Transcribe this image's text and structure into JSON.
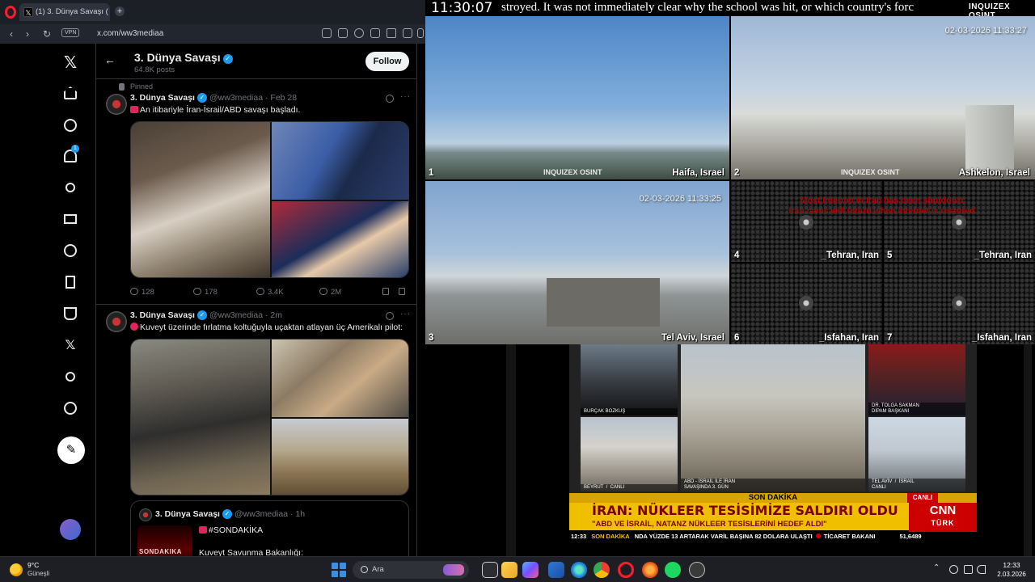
{
  "browser": {
    "tab_title": "(1) 3. Dünya Savaşı (@ww",
    "vpn_label": "VPN",
    "url": "x.com/ww3mediaa"
  },
  "profile": {
    "name": "3. Dünya Savaşı",
    "posts_count": "64.8K posts",
    "follow_label": "Follow"
  },
  "rail": {
    "notification_count": "1"
  },
  "tweets": [
    {
      "pinned_label": "Pinned",
      "author": "3. Dünya Savaşı",
      "handle": "@ww3mediaa · Feb 28",
      "text": "An itibariyle İran-İsrail/ABD savaşı başladı.",
      "replies": "128",
      "reposts": "178",
      "likes": "3.4K",
      "views": "2M"
    },
    {
      "author": "3. Dünya Savaşı",
      "handle": "@ww3mediaa · 2m",
      "text": "Kuveyt üzerinde fırlatma koltuğuyla uçaktan atlayan üç Amerikalı pilot:"
    }
  ],
  "quote": {
    "author": "3. Dünya Savaşı",
    "handle": "@ww3mediaa · 1h",
    "thumb_label": "SONDAKIKA",
    "hashtag": "#SONDAKİKA",
    "line2": "Kuveyt Savunma Bakanlığı:"
  },
  "cams": {
    "clock": "11:30:07",
    "ticker": "stroyed. It was not immediately clear why the school was hit, or which country's forc",
    "brand": "INQUIZEX OSINT",
    "watermark": "INQUIZEX OSINT",
    "shutdown_line1": "Most Internet in Iran has been shutdown.",
    "shutdown_line2": "Iran cams will return when internet is restored.",
    "feeds": [
      {
        "num": "1",
        "label": "Haifa, Israel"
      },
      {
        "num": "2",
        "label": "Ashkelon, Israel",
        "timestamp": "02-03-2026 11:33:27"
      },
      {
        "num": "3",
        "label": "Tel Aviv, Israel",
        "timestamp": "02-03-2026 11:33:25"
      },
      {
        "num": "4",
        "label": "_Tehran, Iran"
      },
      {
        "num": "5",
        "label": "_Tehran, Iran"
      },
      {
        "num": "6",
        "label": "_Isfahan, Iran"
      },
      {
        "num": "7",
        "label": "_Isfahan, Iran"
      }
    ]
  },
  "news": {
    "anchor_name": "BURÇAK BOZKUŞ",
    "guest_name": "DR. TOLGA SAKMAN",
    "guest_title": "DİPAM BAŞKANI",
    "beyrut": "BEYRUT  /  CANLI",
    "center_caption": "ABD - İSRAİL İLE İRAN\nSAVAŞINDA 3. GÜN",
    "telaviv": "TEL AVİV  /  İSRAİL\nCANLI",
    "son_dakika": "SON DAKİKA",
    "canli": "CANLI",
    "headline": "İRAN: NÜKLEER TESİSİMİZE SALDIRI OLDU",
    "subhead": "\"ABD VE İSRAİL, NATANZ NÜKLEER TESİSLERİNİ HEDEF ALDI\"",
    "logo_top": "CNN",
    "logo_bottom": "TÜRK",
    "crawl_time": "12:33",
    "crawl_label": "SON DAKİKA",
    "crawl_text": "NDA YÜZDE 13 ARTARAK VARİL BAŞINA 82 DOLARA ULAŞTI",
    "crawl_text2": "TİCARET BAKANI",
    "crawl_value": "51,6489"
  },
  "taskbar": {
    "temperature": "9°C",
    "condition": "Güneşli",
    "search_placeholder": "Ara",
    "time": "12:33",
    "date": "2.03.2026"
  },
  "colors": {
    "x_blue": "#1d9bf0",
    "cnn_red": "#cc0000",
    "breaking_yellow": "#f0c000",
    "opera_red": "#ff1b2d"
  }
}
